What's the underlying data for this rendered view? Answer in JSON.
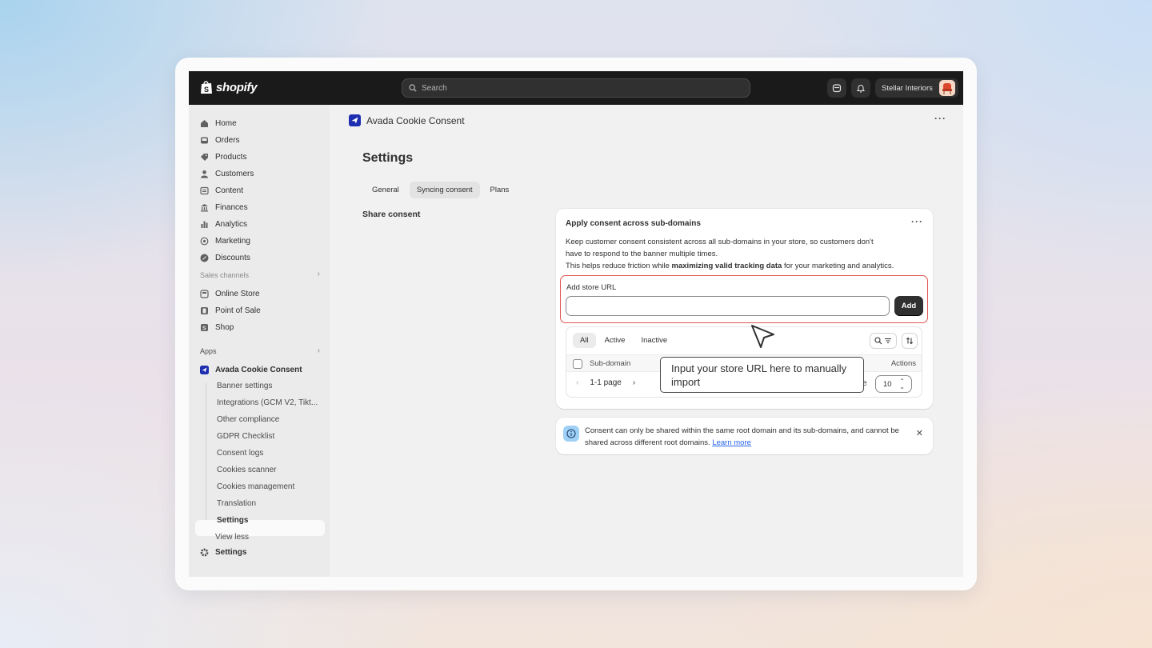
{
  "topbar": {
    "logo_text": "shopify",
    "search_placeholder": "Search",
    "store_name": "Stellar Interiors"
  },
  "sidebar": {
    "main_items": [
      {
        "label": "Home",
        "icon": "home-icon"
      },
      {
        "label": "Orders",
        "icon": "inbox-icon"
      },
      {
        "label": "Products",
        "icon": "tag-icon"
      },
      {
        "label": "Customers",
        "icon": "person-icon"
      },
      {
        "label": "Content",
        "icon": "content-icon"
      },
      {
        "label": "Finances",
        "icon": "bank-icon"
      },
      {
        "label": "Analytics",
        "icon": "bar-chart-icon"
      },
      {
        "label": "Marketing",
        "icon": "target-icon"
      },
      {
        "label": "Discounts",
        "icon": "discount-icon"
      }
    ],
    "sales_channels_label": "Sales channels",
    "sales_channels": [
      {
        "label": "Online Store",
        "icon": "store-icon"
      },
      {
        "label": "Point of Sale",
        "icon": "pos-icon"
      },
      {
        "label": "Shop",
        "icon": "shop-icon"
      }
    ],
    "apps_label": "Apps",
    "app_name": "Avada Cookie Consent",
    "app_subitems": [
      "Banner settings",
      "Integrations (GCM V2, Tikt...",
      "Other compliance",
      "GDPR Checklist",
      "Consent logs",
      "Cookies scanner",
      "Cookies management",
      "Translation",
      "Settings"
    ],
    "view_less": "View less",
    "settings_label": "Settings"
  },
  "main": {
    "app_title": "Avada Cookie Consent",
    "page_title": "Settings",
    "tabs": [
      "General",
      "Syncing consent",
      "Plans"
    ],
    "active_tab": "Syncing consent",
    "section_label": "Share consent",
    "card": {
      "title": "Apply consent across sub-domains",
      "desc_line1": "Keep customer consent consistent across all sub-domains in your store, so customers don't",
      "desc_line2": "have to respond to the banner multiple times.",
      "desc_line3_pre": "This helps reduce friction while ",
      "desc_line3_bold": "maximizing valid tracking data",
      "desc_line3_post": " for your marketing and analytics.",
      "url_label": "Add store URL",
      "url_value": "",
      "add_button": "Add",
      "filter_tabs": [
        "All",
        "Active",
        "Inactive"
      ],
      "col_subdomain": "Sub-domain",
      "col_actions": "Actions",
      "pager_text": "1-1 page",
      "per_page_value": "10",
      "per_page_label_tail": "e"
    },
    "callout": "Input your store URL here to manually import",
    "info": {
      "text": "Consent can only be shared within the same root domain and its sub-domains, and cannot be shared across different root domains.",
      "link": "Learn more"
    }
  },
  "colors": {
    "topbar": "#1a1a1a",
    "highlight_border": "#e25555",
    "link": "#2463eb",
    "app_logo": "#1d2fb0"
  }
}
